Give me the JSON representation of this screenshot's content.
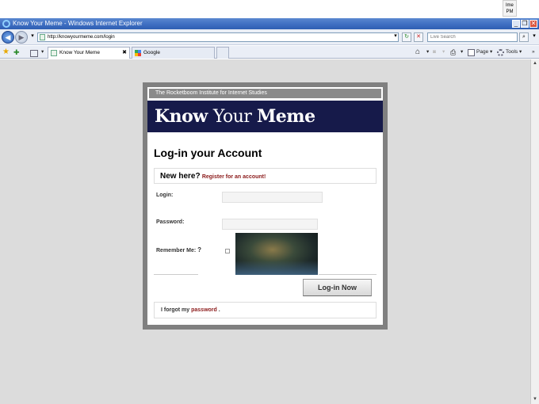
{
  "taskbar": {
    "clock_top": "lme",
    "clock_bottom": "PM"
  },
  "window": {
    "title": "Know Your Meme - Windows Internet Explorer",
    "minimize": "_",
    "restore": "❐",
    "close": "✕"
  },
  "navbar": {
    "back_icon": "◀",
    "forward_icon": "▶",
    "dropdown": "▾",
    "url": "http://knowyourmeme.com/login",
    "refresh": "↻",
    "stop": "✕",
    "search_placeholder": "Live Search",
    "search_icon": "⌕"
  },
  "tabs": {
    "favorites_star": "★",
    "add_favorite": "✚",
    "items": [
      {
        "label": "Know Your Meme",
        "close": "✖"
      },
      {
        "label": "Google"
      }
    ]
  },
  "commandbar": {
    "home": "⌂",
    "feeds": "◙",
    "print": "⎙",
    "page": "Page",
    "tools": "Tools",
    "more": "»"
  },
  "page": {
    "institute": "The Rocketboom Institute for Internet Studies",
    "brand_light": "Know ",
    "brand_mid": "Your ",
    "brand_bold": "Meme",
    "heading": "Log-in your Account",
    "new_here": "New here?",
    "register_link": "Register for an account!",
    "login_label": "Login:",
    "password_label": "Password:",
    "remember_label": "Remember Me:",
    "remember_help": "?",
    "login_button": "Log-in Now",
    "forgot_prefix": "I forgot my ",
    "forgot_link": "password",
    "forgot_suffix": " ."
  },
  "colors": {
    "brand_bg": "#161a4a",
    "link": "#8b1a1a",
    "titlebar": "#3c6cc0",
    "page_bg": "#dcdcdc"
  }
}
